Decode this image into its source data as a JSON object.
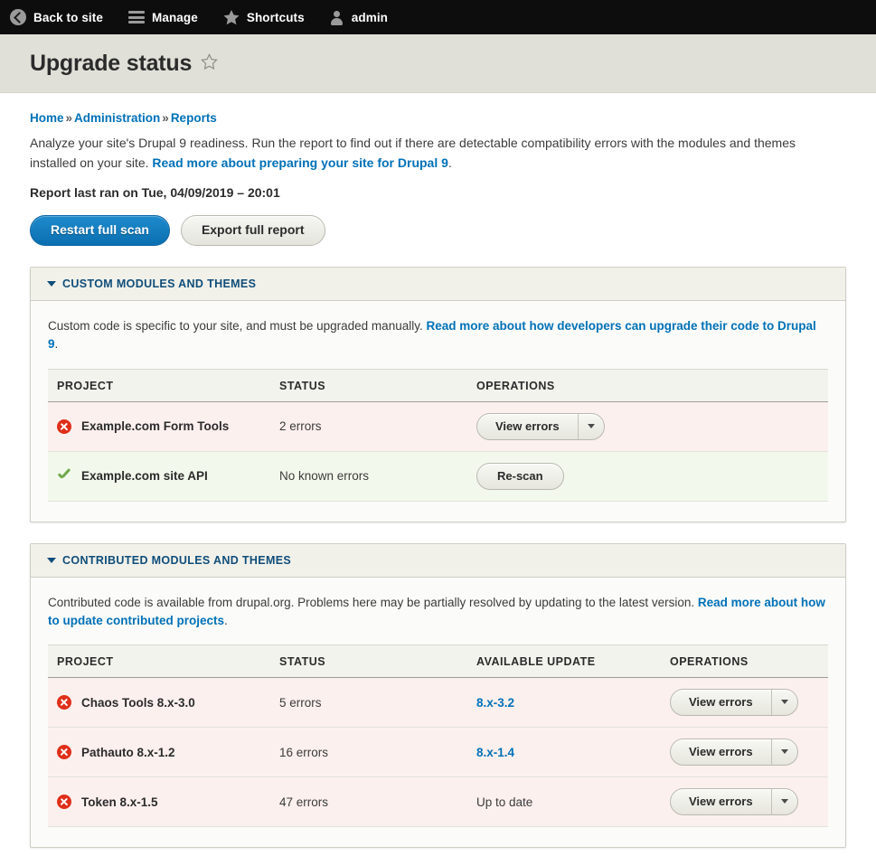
{
  "toolbar": {
    "items": [
      {
        "label": "Back to site",
        "icon": "back-arrow-icon"
      },
      {
        "label": "Manage",
        "icon": "hamburger-icon"
      },
      {
        "label": "Shortcuts",
        "icon": "star-icon"
      },
      {
        "label": "admin",
        "icon": "user-icon"
      }
    ]
  },
  "header": {
    "title": "Upgrade status",
    "favorite_icon": "star-outline-icon"
  },
  "breadcrumb": {
    "items": [
      "Home",
      "Administration",
      "Reports"
    ],
    "separator": "»"
  },
  "intro": {
    "text_before": "Analyze your site's Drupal 9 readiness. Run the report to find out if there are detectable compatibility errors with the modules and themes installed on your site. ",
    "link": "Read more about preparing your site for Drupal 9",
    "text_after": ".",
    "last_ran": "Report last ran on Tue, 04/09/2019 – 20:01"
  },
  "actions": {
    "restart_label": "Restart full scan",
    "export_label": "Export full report"
  },
  "colors": {
    "primary": "#0b6fb0",
    "link": "#0071b8",
    "heading": "#0f4d79",
    "error": "#e02f19",
    "ok": "#6fa849",
    "row_error_bg": "#fcf0ee",
    "row_ok_bg": "#f2f9ec",
    "toolbar_bg": "#0d0d0d",
    "title_band_bg": "#e0e0d9"
  },
  "custom_section": {
    "title": "Custom modules and themes",
    "desc_before": "Custom code is specific to your site, and must be upgraded manually. ",
    "desc_link": "Read more about how developers can upgrade their code to Drupal 9",
    "desc_after": ".",
    "columns": [
      "Project",
      "Status",
      "Operations"
    ],
    "rows": [
      {
        "icon": "error-icon",
        "state": "error",
        "project": "Example.com Form Tools",
        "status": "2 errors",
        "operation": "View errors",
        "has_toggle": true
      },
      {
        "icon": "check-icon",
        "state": "ok",
        "project": "Example.com site API",
        "status": "No known errors",
        "operation": "Re-scan",
        "has_toggle": false
      }
    ]
  },
  "contributed_section": {
    "title": "Contributed modules and themes",
    "desc_before": "Contributed code is available from drupal.org. Problems here may be partially resolved by updating to the latest version. ",
    "desc_link": "Read more about how to update contributed projects",
    "desc_after": ".",
    "columns": [
      "Project",
      "Status",
      "Available update",
      "Operations"
    ],
    "rows": [
      {
        "icon": "error-icon",
        "state": "error",
        "project": "Chaos Tools 8.x-3.0",
        "status": "5 errors",
        "update": "8.x-3.2",
        "update_is_link": true,
        "operation": "View errors",
        "has_toggle": true
      },
      {
        "icon": "error-icon",
        "state": "error",
        "project": "Pathauto 8.x-1.2",
        "status": "16 errors",
        "update": "8.x-1.4",
        "update_is_link": true,
        "operation": "View errors",
        "has_toggle": true
      },
      {
        "icon": "error-icon",
        "state": "error",
        "project": "Token 8.x-1.5",
        "status": "47 errors",
        "update": "Up to date",
        "update_is_link": false,
        "operation": "View errors",
        "has_toggle": true
      }
    ]
  }
}
